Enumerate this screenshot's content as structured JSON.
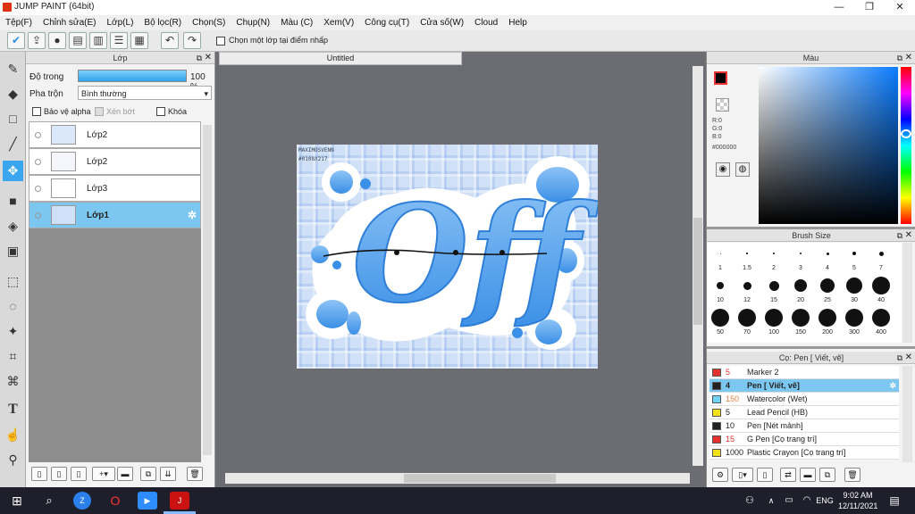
{
  "app": {
    "title": "JUMP PAINT (64bit)"
  },
  "menu": [
    "Tệp(F)",
    "Chỉnh sửa(E)",
    "Lớp(L)",
    "Bộ lọc(R)",
    "Chọn(S)",
    "Chụp(N)",
    "Màu (C)",
    "Xem(V)",
    "Công cụ(T)",
    "Cửa số(W)",
    "Cloud",
    "Help"
  ],
  "toolbar": {
    "select_layer_label": "Chọn một lớp tại điểm nhấp"
  },
  "layer_panel": {
    "title": "Lớp",
    "opacity_label": "Độ trong",
    "opacity_value": "100 %",
    "opacity_fraction": 1.0,
    "blend_label": "Pha trộn",
    "blend_value": "Bình thường",
    "protect_alpha": "Bảo vệ alpha",
    "clip": "Xén bớt",
    "lock": "Khóa",
    "layers": [
      {
        "name": "Lớp2"
      },
      {
        "name": "Lớp2"
      },
      {
        "name": "Lớp3"
      },
      {
        "name": "Lớp1"
      }
    ]
  },
  "document": {
    "tab_title": "Untitled",
    "art_text": "Off",
    "art_caption_1": "MAXIMOSVENN",
    "art_caption_2": "#0108X217"
  },
  "color_panel": {
    "title": "Màu",
    "r": "R:0",
    "g": "G:0",
    "b": "B:0",
    "hex": "#000000"
  },
  "brush_size_panel": {
    "title": "Brush Size",
    "sizes": [
      "1",
      "1.5",
      "2",
      "3",
      "4",
      "5",
      "7",
      "10",
      "12",
      "15",
      "20",
      "25",
      "30",
      "40",
      "50",
      "70",
      "100",
      "150",
      "200",
      "300",
      "400"
    ]
  },
  "brush_panel": {
    "title": "Cọ: Pen [ Viết, vẽ]",
    "brushes": [
      {
        "size": "5",
        "name": "Marker 2",
        "color": "#e53030"
      },
      {
        "size": "4",
        "name": "Pen [ Viết, vẽ]",
        "color": "#222222"
      },
      {
        "size": "150",
        "name": "Watercolor (Wet)",
        "color": "#6fd4f5"
      },
      {
        "size": "5",
        "name": "Lead Pencil (HB)",
        "color": "#f2e21a"
      },
      {
        "size": "10",
        "name": "Pen [Nét mảnh]",
        "color": "#222222"
      },
      {
        "size": "15",
        "name": "G Pen [Cọ trang trí]",
        "color": "#e53030"
      },
      {
        "size": "1000",
        "name": "Plastic Crayon [Cọ trang trí]",
        "color": "#f2e21a"
      }
    ]
  },
  "taskbar": {
    "time": "9:02 AM",
    "date": "12/11/2021",
    "lang": "ENG"
  },
  "colors": {
    "accent": "#3aa6f0",
    "selected_row": "#7cc7ef"
  }
}
